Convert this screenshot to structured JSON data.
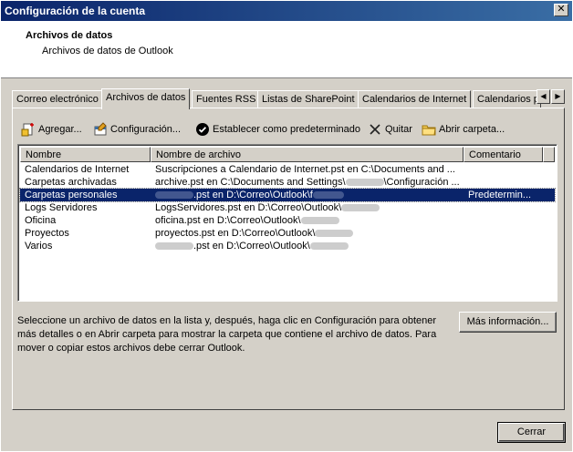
{
  "window": {
    "title": "Configuración de la cuenta",
    "close_glyph": "✕"
  },
  "header": {
    "title": "Archivos de datos",
    "subtitle": "Archivos de datos de Outlook"
  },
  "tabs": [
    {
      "label": "Correo electrónico",
      "active": false
    },
    {
      "label": "Archivos de datos",
      "active": true
    },
    {
      "label": "Fuentes RSS",
      "active": false
    },
    {
      "label": "Listas de SharePoint",
      "active": false
    },
    {
      "label": "Calendarios de Internet",
      "active": false
    },
    {
      "label": "Calendarios p",
      "active": false
    }
  ],
  "tab_scroll": {
    "left": "◀",
    "right": "▶"
  },
  "toolbar": {
    "add": "Agregar...",
    "settings": "Configuración...",
    "set_default": "Establecer como predeterminado",
    "remove": "Quitar",
    "open_folder": "Abrir carpeta..."
  },
  "list": {
    "columns": [
      "Nombre",
      "Nombre de archivo",
      "Comentario"
    ],
    "rows": [
      {
        "name": "Calendarios de Internet",
        "file": "Suscripciones a Calendario de Internet.pst en C:\\Documents and ...",
        "comment": "",
        "selected": false
      },
      {
        "name": "Carpetas archivadas",
        "file": "archive.pst en C:\\Documents and Settings\\",
        "file_tail": "\\Configuración ...",
        "comment": "",
        "selected": false
      },
      {
        "name": "Carpetas personales",
        "file_pre": "",
        "file": ".pst en D:\\Correo\\Outlook\\f",
        "comment": "Predetermin...",
        "selected": true
      },
      {
        "name": "Logs Servidores",
        "file": "LogsServidores.pst en D:\\Correo\\Outlook\\",
        "comment": "",
        "selected": false
      },
      {
        "name": "Oficina",
        "file": "oficina.pst en D:\\Correo\\Outlook\\",
        "comment": "",
        "selected": false
      },
      {
        "name": "Proyectos",
        "file": "proyectos.pst en D:\\Correo\\Outlook\\",
        "comment": "",
        "selected": false
      },
      {
        "name": "Varios",
        "file_pre": "",
        "file": ".pst en D:\\Correo\\Outlook\\",
        "comment": "",
        "selected": false
      }
    ]
  },
  "info_text": "Seleccione un archivo de datos en la lista y, después, haga clic en Configuración para obtener más detalles o en Abrir carpeta para mostrar la carpeta que contiene el archivo de datos. Para mover o copiar estos archivos debe cerrar Outlook.",
  "buttons": {
    "more_info": "Más información...",
    "close": "Cerrar"
  }
}
